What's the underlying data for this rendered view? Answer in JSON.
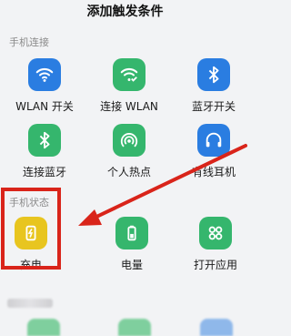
{
  "header": {
    "title": "添加触发条件"
  },
  "sections": [
    {
      "title": "手机连接",
      "items": [
        {
          "label": "WLAN 开关",
          "icon": "wifi-icon",
          "color": "#2a7de1"
        },
        {
          "label": "连接 WLAN",
          "icon": "wifi-connect-icon",
          "color": "#35b66d"
        },
        {
          "label": "蓝牙开关",
          "icon": "bluetooth-icon",
          "color": "#2a7de1"
        },
        {
          "label": "连接蓝牙",
          "icon": "bluetooth-connect-icon",
          "color": "#35b66d"
        },
        {
          "label": "个人热点",
          "icon": "hotspot-icon",
          "color": "#35b66d"
        },
        {
          "label": "有线耳机",
          "icon": "headphones-icon",
          "color": "#2a7de1"
        }
      ]
    },
    {
      "title": "手机状态",
      "items": [
        {
          "label": "充电",
          "icon": "charging-icon",
          "color": "#e8c51f",
          "highlighted": true
        },
        {
          "label": "电量",
          "icon": "battery-icon",
          "color": "#35b66d"
        },
        {
          "label": "打开应用",
          "icon": "apps-icon",
          "color": "#35b66d"
        }
      ]
    }
  ],
  "annotation": {
    "color": "#d9241a"
  }
}
